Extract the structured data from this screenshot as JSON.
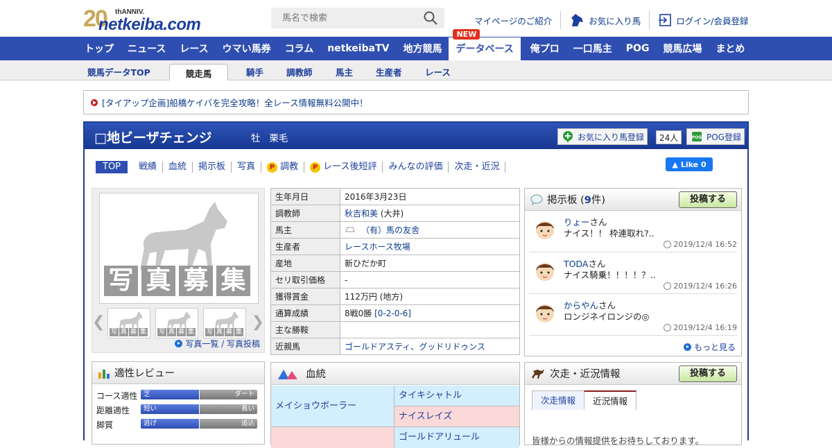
{
  "header": {
    "logo_anniv_num": "20",
    "logo_anniv_text": "thANNIV.",
    "logo_brand": "netkeiba.com",
    "search_placeholder": "馬名で検索",
    "link_mypage": "マイページのご紹介",
    "link_favorites": "お気に入り馬",
    "link_login": "ログイン/会員登録"
  },
  "global_nav": {
    "items": [
      "トップ",
      "ニュース",
      "レース",
      "ウマい馬券",
      "コラム",
      "netkeibaTV",
      "地方競馬",
      "データベース",
      "俺プロ",
      "一口馬主",
      "POG",
      "競馬広場",
      "まとめ"
    ],
    "new_badge": "NEW"
  },
  "sub_nav": {
    "items": [
      "競馬データTOP",
      "競走馬",
      "騎手",
      "調教師",
      "馬主",
      "生産者",
      "レース"
    ]
  },
  "notice": "[タイアップ企画]船橋ケイバを完全攻略！全レース情報無料公開中！",
  "horse": {
    "name": "□地ビーザチェンジ",
    "sex": "牡",
    "color": "栗毛",
    "fav_button": "お気に入り馬登録",
    "fav_count": "24人",
    "pog_button": "POG登録"
  },
  "tabs": [
    "TOP",
    "戦績",
    "血統",
    "掲示板",
    "写真",
    "調教",
    "レース後短評",
    "みんなの評価",
    "次走・近況"
  ],
  "fb_like": "Like 0",
  "photo": {
    "bosyu_chars": [
      "写",
      "真",
      "募",
      "集"
    ],
    "links": "写真一覧 / 写真投稿"
  },
  "profile": [
    {
      "k": "生年月日",
      "v": "2016年3月23日",
      "link": ""
    },
    {
      "k": "調教師",
      "v": " (大井)",
      "link": "秋吉和美"
    },
    {
      "k": "馬主",
      "v": "",
      "link": "（有）馬の友舎"
    },
    {
      "k": "生産者",
      "v": "",
      "link": "レースホース牧場"
    },
    {
      "k": "産地",
      "v": "新ひだか町",
      "link": ""
    },
    {
      "k": "セリ取引価格",
      "v": "-",
      "link": ""
    },
    {
      "k": "獲得賞金",
      "v": "112万円 (地方)",
      "link": ""
    },
    {
      "k": "通算成績",
      "v": "8戦0勝 ",
      "link": "[0-2-0-6]"
    },
    {
      "k": "主な勝鞍",
      "v": "",
      "link": ""
    },
    {
      "k": "近親馬",
      "v": "",
      "link": "ゴールドアスティ、グッドリドゥンス"
    }
  ],
  "bbs": {
    "title_prefix": "掲示板 (",
    "count": "9",
    "title_suffix": "件)",
    "post_button": "投稿する",
    "posts": [
      {
        "name": "りょー",
        "san": "さん",
        "msg": "ナイス！！ 枠連取れ?..",
        "time": "2019/12/4 16:52"
      },
      {
        "name": "TODA",
        "san": "さん",
        "msg": "ナイス騎乗！！！！？..",
        "time": "2019/12/4 16:26"
      },
      {
        "name": "からやん",
        "san": "さん",
        "msg": "ロンジネイロンジの◎",
        "time": "2019/12/4 16:19"
      }
    ],
    "more": "もっと見る"
  },
  "review": {
    "title": "適性レビュー",
    "rows": [
      {
        "label": "コース適性",
        "left": "芝",
        "right": "ダート",
        "value": 0.5
      },
      {
        "label": "距離適性",
        "left": "短い",
        "right": "長い",
        "value": 0.5
      },
      {
        "label": "脚質",
        "left": "逃げ",
        "right": "追込",
        "value": 0.5
      }
    ]
  },
  "pedigree": {
    "title": "血統",
    "sire": "メイショウボーラー",
    "sire_sire": "タイキシャトル",
    "sire_dam": "ナイスレイズ",
    "dam_sire": "ゴールドアリュール"
  },
  "next": {
    "title": "次走・近況情報",
    "post_button": "投稿する",
    "tabs": [
      "次走情報",
      "近況情報"
    ],
    "text": "皆様からの情報提供をお待ちしております。"
  },
  "colors": {
    "nav_blue": "#2f4eb1",
    "title_blue": "#173790",
    "new_red": "#e0301e"
  }
}
